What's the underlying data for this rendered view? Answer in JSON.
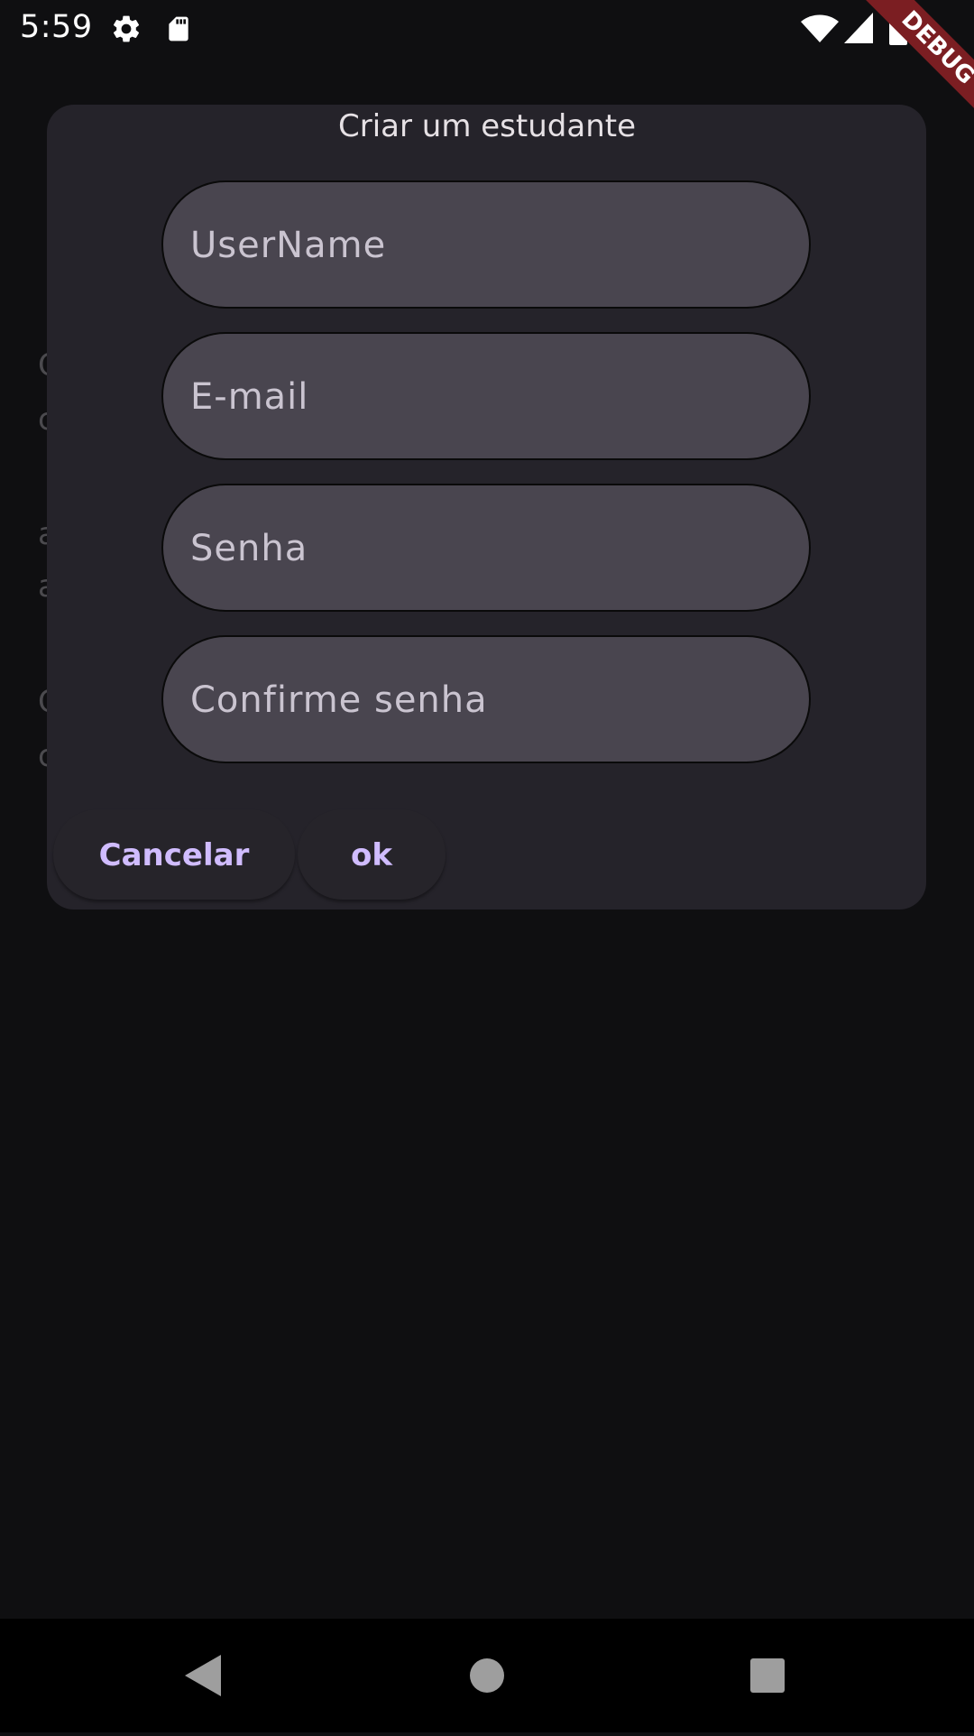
{
  "status_bar": {
    "time": "5:59",
    "icons": [
      "settings-icon",
      "sd-card-icon",
      "wifi-icon",
      "cell-signal-icon",
      "battery-icon"
    ]
  },
  "debug_banner": {
    "label": "DEBUG",
    "color": "#7b1e22"
  },
  "dialog": {
    "title": "Criar um estudante",
    "fields": [
      {
        "placeholder": "UserName",
        "value": ""
      },
      {
        "placeholder": "E-mail",
        "value": ""
      },
      {
        "placeholder": "Senha",
        "value": ""
      },
      {
        "placeholder": "Confirme senha",
        "value": ""
      }
    ],
    "buttons": {
      "cancel": "Cancelar",
      "ok": "ok"
    }
  },
  "nav_bar": {
    "icons": [
      "back-icon",
      "home-icon",
      "recents-icon"
    ]
  },
  "colors": {
    "background": "#0f0f11",
    "dialog_surface": "#25232a",
    "field_fill": "#49454f",
    "accent": "#d0bcff"
  }
}
